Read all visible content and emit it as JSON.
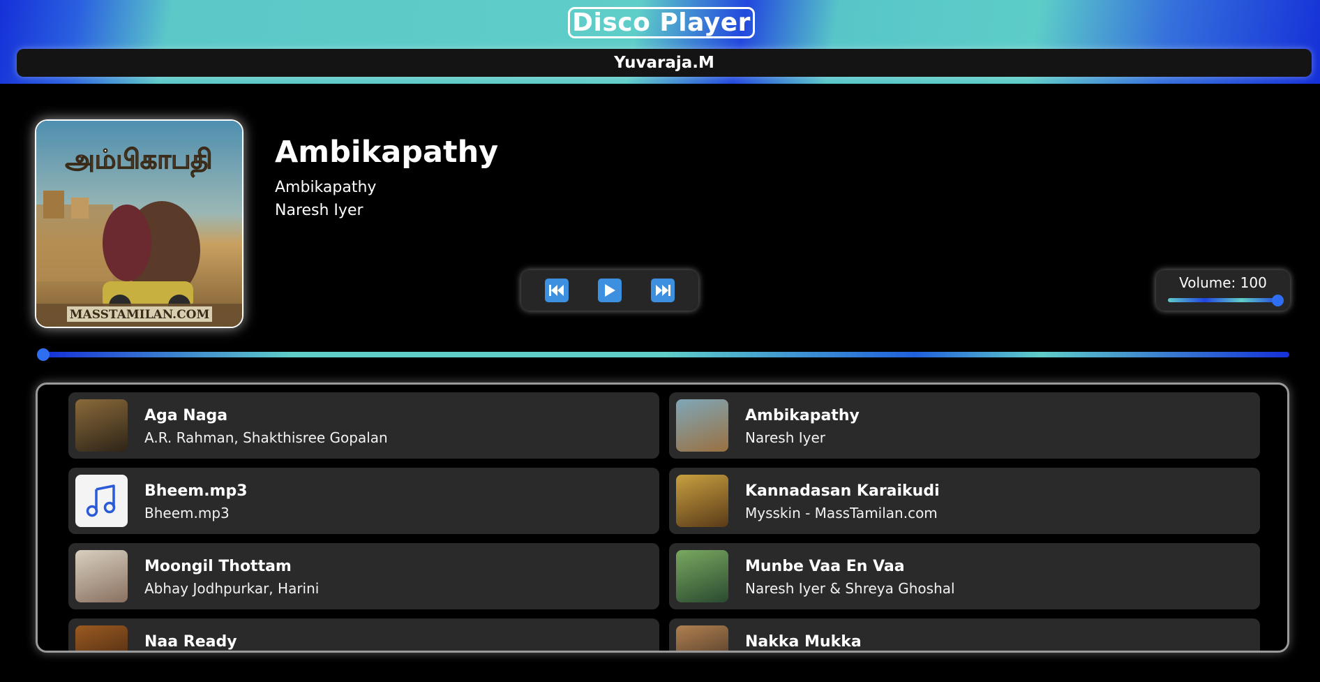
{
  "header": {
    "app_title": "Disco Player",
    "user_name": "Yuvaraja.M"
  },
  "now_playing": {
    "title": "Ambikapathy",
    "album": "Ambikapathy",
    "artist": "Naresh Iyer",
    "album_art_text": "அம்பிகாபதி",
    "album_art_footer": "MASSTAMILAN.COM",
    "progress_fraction": 0.0,
    "is_playing": false
  },
  "controls": {
    "previous": "previous-icon",
    "play": "play-icon",
    "next": "next-icon"
  },
  "volume": {
    "label": "Volume: 100",
    "value": 100
  },
  "playlist": [
    {
      "title": "Aga Naga",
      "artist": "A.R. Rahman, Shakthisree Gopalan",
      "thumb_colors": [
        "#8a6a3a",
        "#2e2418"
      ]
    },
    {
      "title": "Ambikapathy",
      "artist": "Naresh Iyer",
      "thumb_colors": [
        "#7fa7b8",
        "#9a7040"
      ]
    },
    {
      "title": "Bheem.mp3",
      "artist": "Bheem.mp3",
      "thumb_colors": [
        "#f4f4f4",
        "#f4f4f4"
      ],
      "icon": "music-note-icon"
    },
    {
      "title": "Kannadasan Karaikudi",
      "artist": "Mysskin - MassTamilan.com",
      "thumb_colors": [
        "#c8a040",
        "#5a3a18"
      ]
    },
    {
      "title": "Moongil Thottam",
      "artist": "Abhay Jodhpurkar, Harini",
      "thumb_colors": [
        "#d8d0c0",
        "#8a7060"
      ]
    },
    {
      "title": "Munbe Vaa En Vaa",
      "artist": "Naresh Iyer & Shreya Ghoshal",
      "thumb_colors": [
        "#7aa860",
        "#2a4a30"
      ]
    },
    {
      "title": "Naa Ready",
      "artist": "",
      "thumb_colors": [
        "#9a5a20",
        "#3a2010"
      ]
    },
    {
      "title": "Nakka Mukka",
      "artist": "",
      "thumb_colors": [
        "#b08050",
        "#3a2a20"
      ]
    }
  ]
}
